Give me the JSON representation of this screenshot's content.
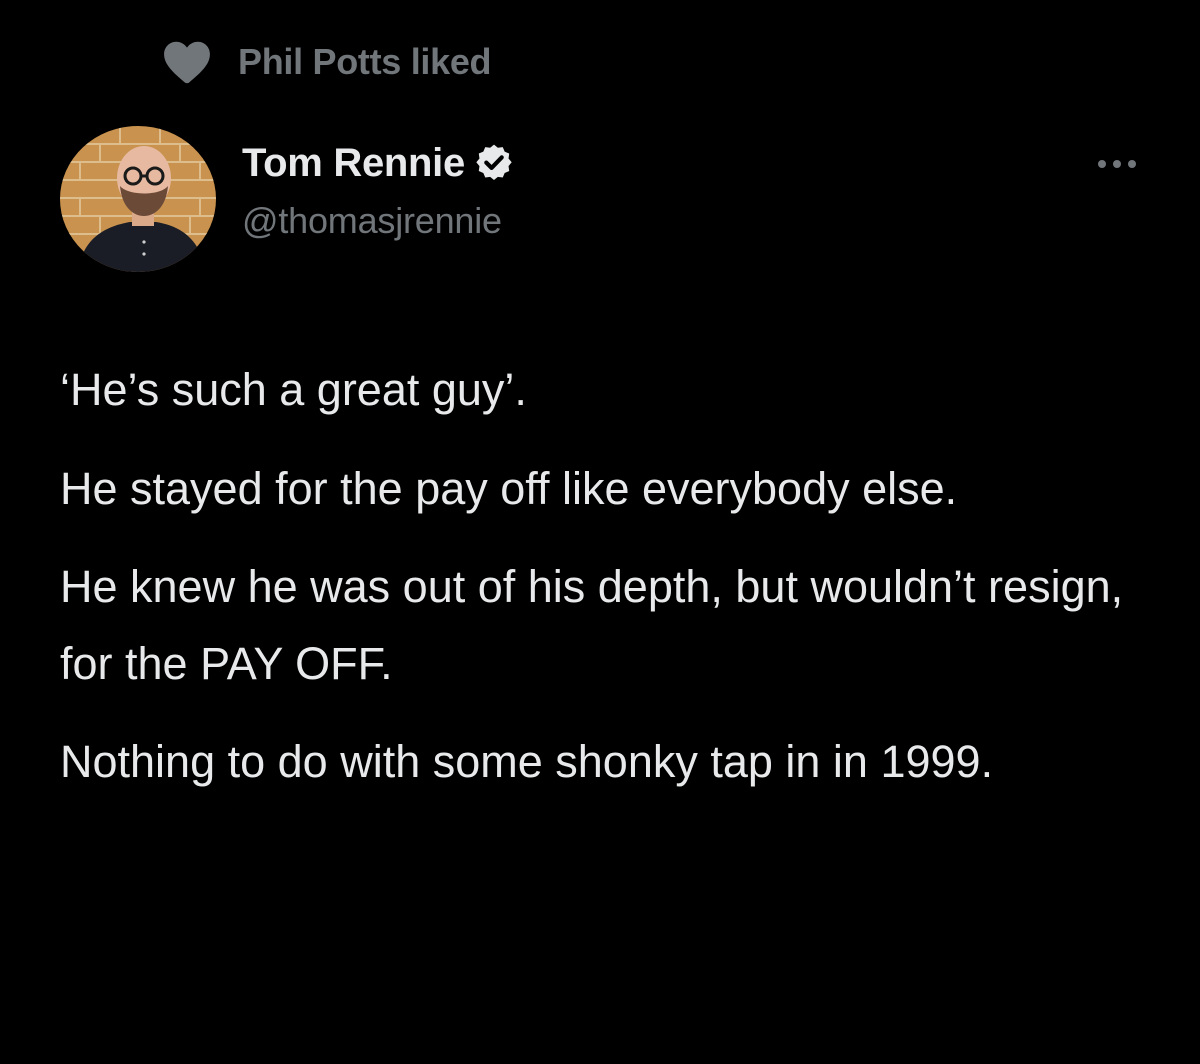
{
  "social_context": {
    "icon": "heart-icon",
    "text": "Phil Potts liked"
  },
  "author": {
    "name": "Tom Rennie",
    "handle": "@thomasjrennie",
    "verified": true,
    "avatar": "avatar"
  },
  "menu": {
    "icon": "more-options-icon"
  },
  "tweet": {
    "paragraphs": [
      "‘He’s such a great guy’.",
      "He stayed for the pay off like everybody else.",
      "He knew he was out of his depth, but wouldn’t resign, for the PAY OFF.",
      "Nothing to do with some shonky tap in in 1999."
    ]
  },
  "colors": {
    "background": "#000000",
    "primary_text": "#e7e9ea",
    "secondary_text": "#71767b",
    "verified_badge": "#e7e9ea"
  }
}
